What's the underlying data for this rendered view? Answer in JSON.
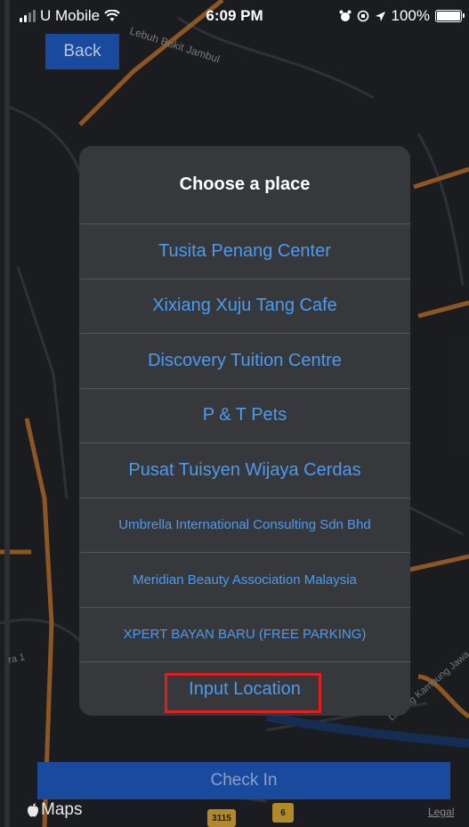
{
  "status_bar": {
    "carrier": "U Mobile",
    "time": "6:09 PM",
    "battery": "100%"
  },
  "map": {
    "street_labels": [
      "Lebuh Bukit Jambul",
      "Lintang Kampung Jawa",
      "ra 1"
    ],
    "road_shields": [
      "3115",
      "6"
    ],
    "maps_label": "Maps",
    "legal_label": "Legal"
  },
  "back_button": {
    "label": "Back"
  },
  "modal": {
    "title": "Choose a place",
    "options": [
      "Tusita Penang Center",
      "Xixiang Xuju Tang Cafe",
      "Discovery Tuition Centre",
      "P & T Pets",
      "Pusat Tuisyen Wijaya Cerdas",
      "Umbrella International Consulting Sdn Bhd",
      "Meridian Beauty Association Malaysia",
      "XPERT BAYAN BARU (FREE PARKING)",
      "Input Location"
    ]
  },
  "checkin_button": {
    "label": "Check In"
  },
  "colors": {
    "accent_blue": "#4b9bf0",
    "button_blue": "#1a4a9e",
    "highlight_red": "#e01e1e",
    "road_orange": "#b5702e"
  }
}
